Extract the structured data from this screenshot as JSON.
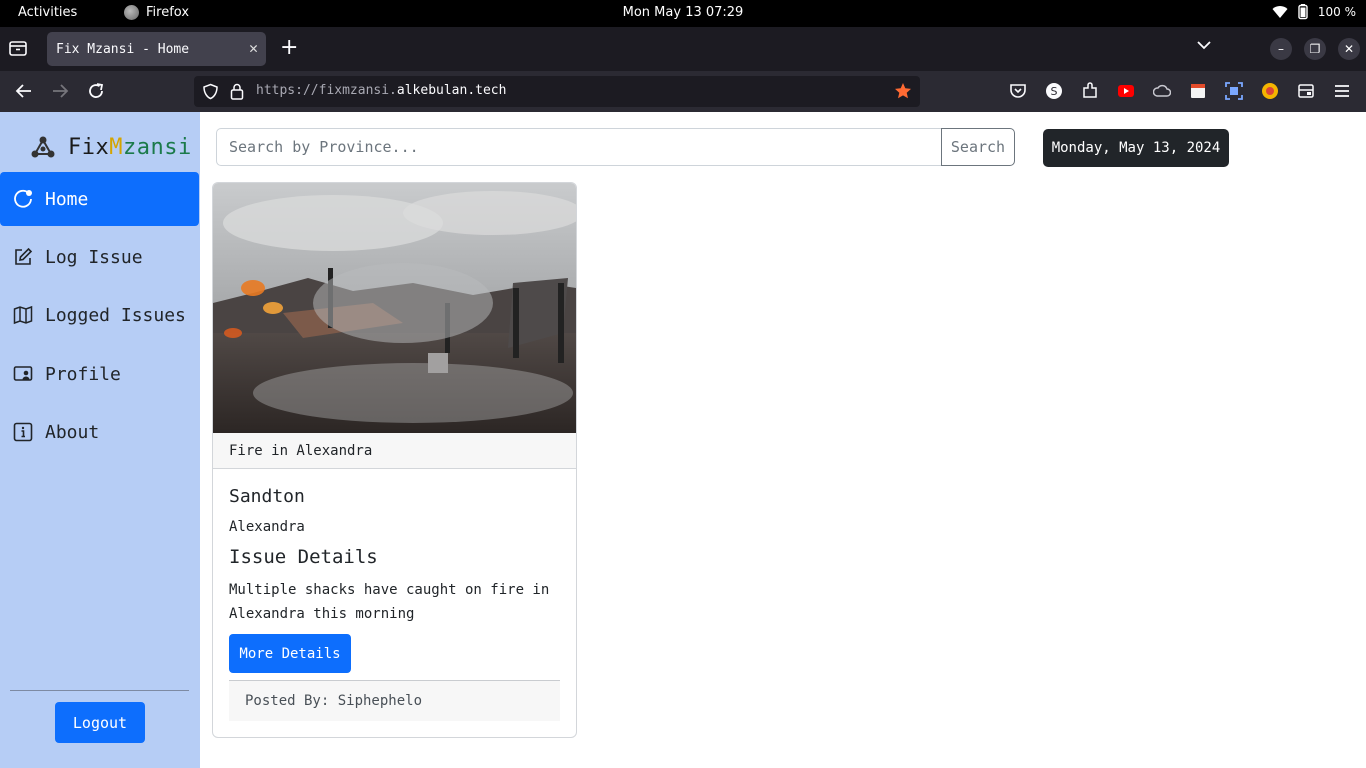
{
  "system_bar": {
    "activities": "Activities",
    "app_name": "Firefox",
    "clock": "Mon May 13 07:29",
    "battery": "100 %"
  },
  "browser": {
    "tab_title": "Fix Mzansi - Home",
    "url_prefix": "https://fixmzansi.",
    "url_domain": "alkebulan.tech"
  },
  "sidebar": {
    "brand_fix": "Fix",
    "brand_m": "M",
    "brand_zansi": "zansi",
    "items": [
      {
        "label": "Home",
        "icon": "home-icon"
      },
      {
        "label": "Log Issue",
        "icon": "pencil-square-icon"
      },
      {
        "label": "Logged Issues",
        "icon": "map-icon"
      },
      {
        "label": "Profile",
        "icon": "person-card-icon"
      },
      {
        "label": "About",
        "icon": "info-square-icon"
      }
    ],
    "logout": "Logout"
  },
  "search": {
    "placeholder": "Search by Province...",
    "button": "Search"
  },
  "date": "Monday, May 13, 2024",
  "issue_card": {
    "header": "Fire in Alexandra",
    "area": "Sandton",
    "suburb": "Alexandra",
    "details_heading": "Issue Details",
    "description": "Multiple shacks have caught on fire in Alexandra this morning",
    "button": "More Details",
    "posted_by": "Posted By: Siphephelo"
  }
}
